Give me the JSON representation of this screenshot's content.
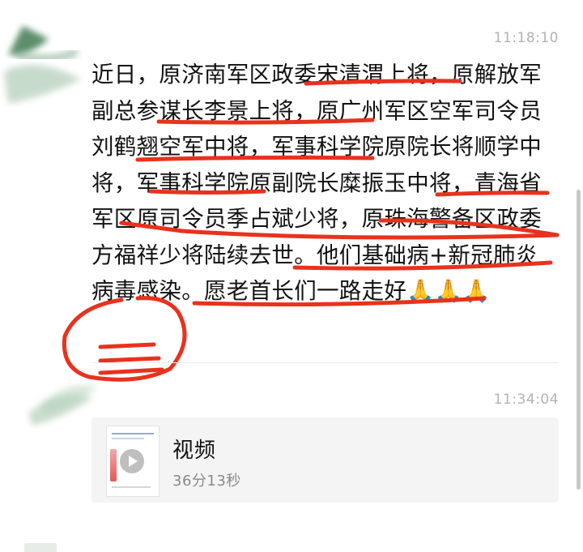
{
  "chat": {
    "messages": [
      {
        "timestamp": "11:18:10",
        "text": "近日，原济南军区政委宋清渭上将，原解放军副总参谋长李景上将，原广州军区空军司令员刘鹤翘空军中将，军事科学院原院长将顺学中将，军事科学院原副院长糜振玉中将，青海省军区原司令员季占斌少将，原珠海警备区政委方福祥少将陆续去世。他们基础病+新冠肺炎病毒感染。愿老首长们一路走好",
        "emoji": "🙏🙏🙏"
      },
      {
        "timestamp": "11:34:04",
        "video": {
          "title": "视频",
          "duration": "36分13秒"
        }
      }
    ]
  },
  "colors": {
    "annotation_red": "#e8321e",
    "timestamp_gray": "#b2b2b2",
    "card_bg": "#f4f4f4"
  },
  "icons": {
    "play": "play-icon",
    "prayer": "folded-hands-emoji"
  }
}
